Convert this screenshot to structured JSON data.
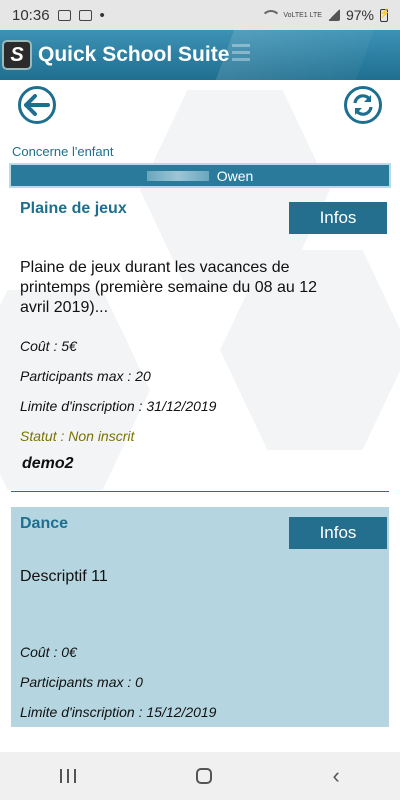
{
  "status_bar": {
    "time": "10:36",
    "left_icons": [
      "image-icon",
      "mail-icon",
      "dot-icon"
    ],
    "lte_label": "VoLTE1 LTE",
    "battery": "97%"
  },
  "app_bar": {
    "title": "Quick School Suite",
    "logo_letter": "S"
  },
  "header": {
    "concerne_label": "Concerne l'enfant",
    "child_name": "Owen"
  },
  "activities": [
    {
      "title": "Plaine de jeux",
      "infos_label": "Infos",
      "description": "Plaine de jeux durant les vacances de printemps (première semaine du 08 au 12 avril 2019)...",
      "cout": "Coût : 5€",
      "participants": "Participants max : 20",
      "limite": "Limite d'inscription : 31/12/2019",
      "statut": "Statut : Non inscrit",
      "owner": "demo2"
    },
    {
      "title": "Dance",
      "infos_label": "Infos",
      "description": "Descriptif 11",
      "cout": "Coût : 0€",
      "participants": "Participants max : 0",
      "limite": "Limite d'inscription : 15/12/2019"
    }
  ],
  "colors": {
    "accent": "#1e6f8f",
    "appbar": "#2a7b9b",
    "card2_bg": "#b5d6e0",
    "status_text": "#7a7300"
  }
}
